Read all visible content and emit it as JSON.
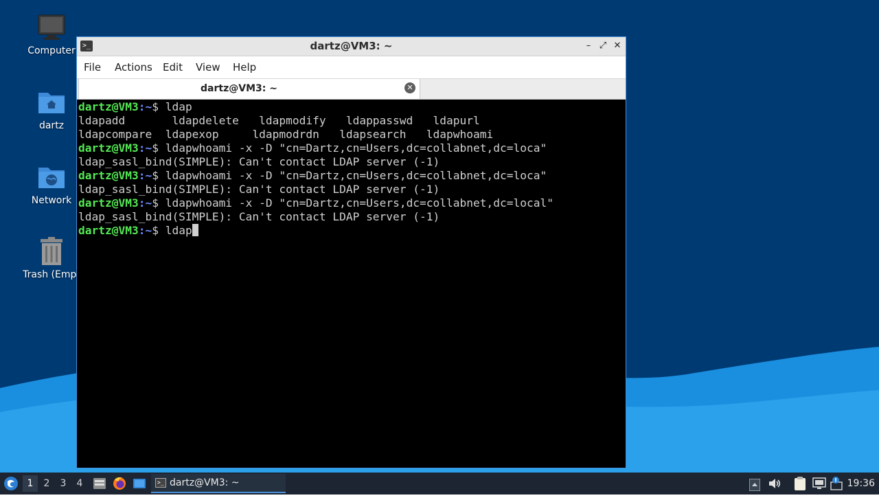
{
  "desktop": {
    "icons": [
      {
        "label": "Computer",
        "icon": "computer-icon"
      },
      {
        "label": "dartz",
        "icon": "home-folder-icon"
      },
      {
        "label": "Network",
        "icon": "network-folder-icon"
      },
      {
        "label": "Trash (Empt",
        "icon": "trash-icon"
      }
    ],
    "colors": {
      "background": "#003a73",
      "wave": "#1a8fe0"
    }
  },
  "window": {
    "title": "dartz@VM3: ~",
    "controls": {
      "minimize": "–",
      "maximize": "⤢",
      "close": "✕"
    },
    "menu": [
      "File",
      "Actions",
      "Edit",
      "View",
      "Help"
    ],
    "tab": {
      "label": "dartz@VM3: ~",
      "close": "✕"
    }
  },
  "terminal": {
    "prompt_user": "dartz@VM3",
    "prompt_path": ":~",
    "prompt_symbol": "$ ",
    "lines": [
      {
        "type": "prompt",
        "cmd": "ldap"
      },
      {
        "type": "output",
        "text": "ldapadd       ldapdelete   ldapmodify   ldappasswd   ldapurl"
      },
      {
        "type": "output",
        "text": "ldapcompare  ldapexop     ldapmodrdn   ldapsearch   ldapwhoami"
      },
      {
        "type": "prompt",
        "cmd": "ldapwhoami -x -D \"cn=Dartz,cn=Users,dc=collabnet,dc=loca\""
      },
      {
        "type": "output",
        "text": "ldap_sasl_bind(SIMPLE): Can't contact LDAP server (-1)"
      },
      {
        "type": "prompt",
        "cmd": "ldapwhoami -x -D \"cn=Dartz,cn=Users,dc=collabnet,dc=loca\""
      },
      {
        "type": "output",
        "text": "ldap_sasl_bind(SIMPLE): Can't contact LDAP server (-1)"
      },
      {
        "type": "prompt",
        "cmd": "ldapwhoami -x -D \"cn=Dartz,cn=Users,dc=collabnet,dc=local\""
      },
      {
        "type": "output",
        "text": "ldap_sasl_bind(SIMPLE): Can't contact LDAP server (-1)"
      },
      {
        "type": "prompt",
        "cmd": "ldap",
        "cursor": true
      }
    ]
  },
  "taskbar": {
    "workspaces": [
      "1",
      "2",
      "3",
      "4"
    ],
    "active_workspace": "1",
    "launchers": [
      "file-manager-icon",
      "firefox-icon",
      "show-desktop-icon"
    ],
    "task": {
      "label": "dartz@VM3: ~"
    },
    "tray": [
      "tray-expand-icon",
      "volume-icon",
      "clipboard-icon",
      "network-monitor-icon",
      "notification-icon"
    ],
    "clock": "19:36"
  }
}
